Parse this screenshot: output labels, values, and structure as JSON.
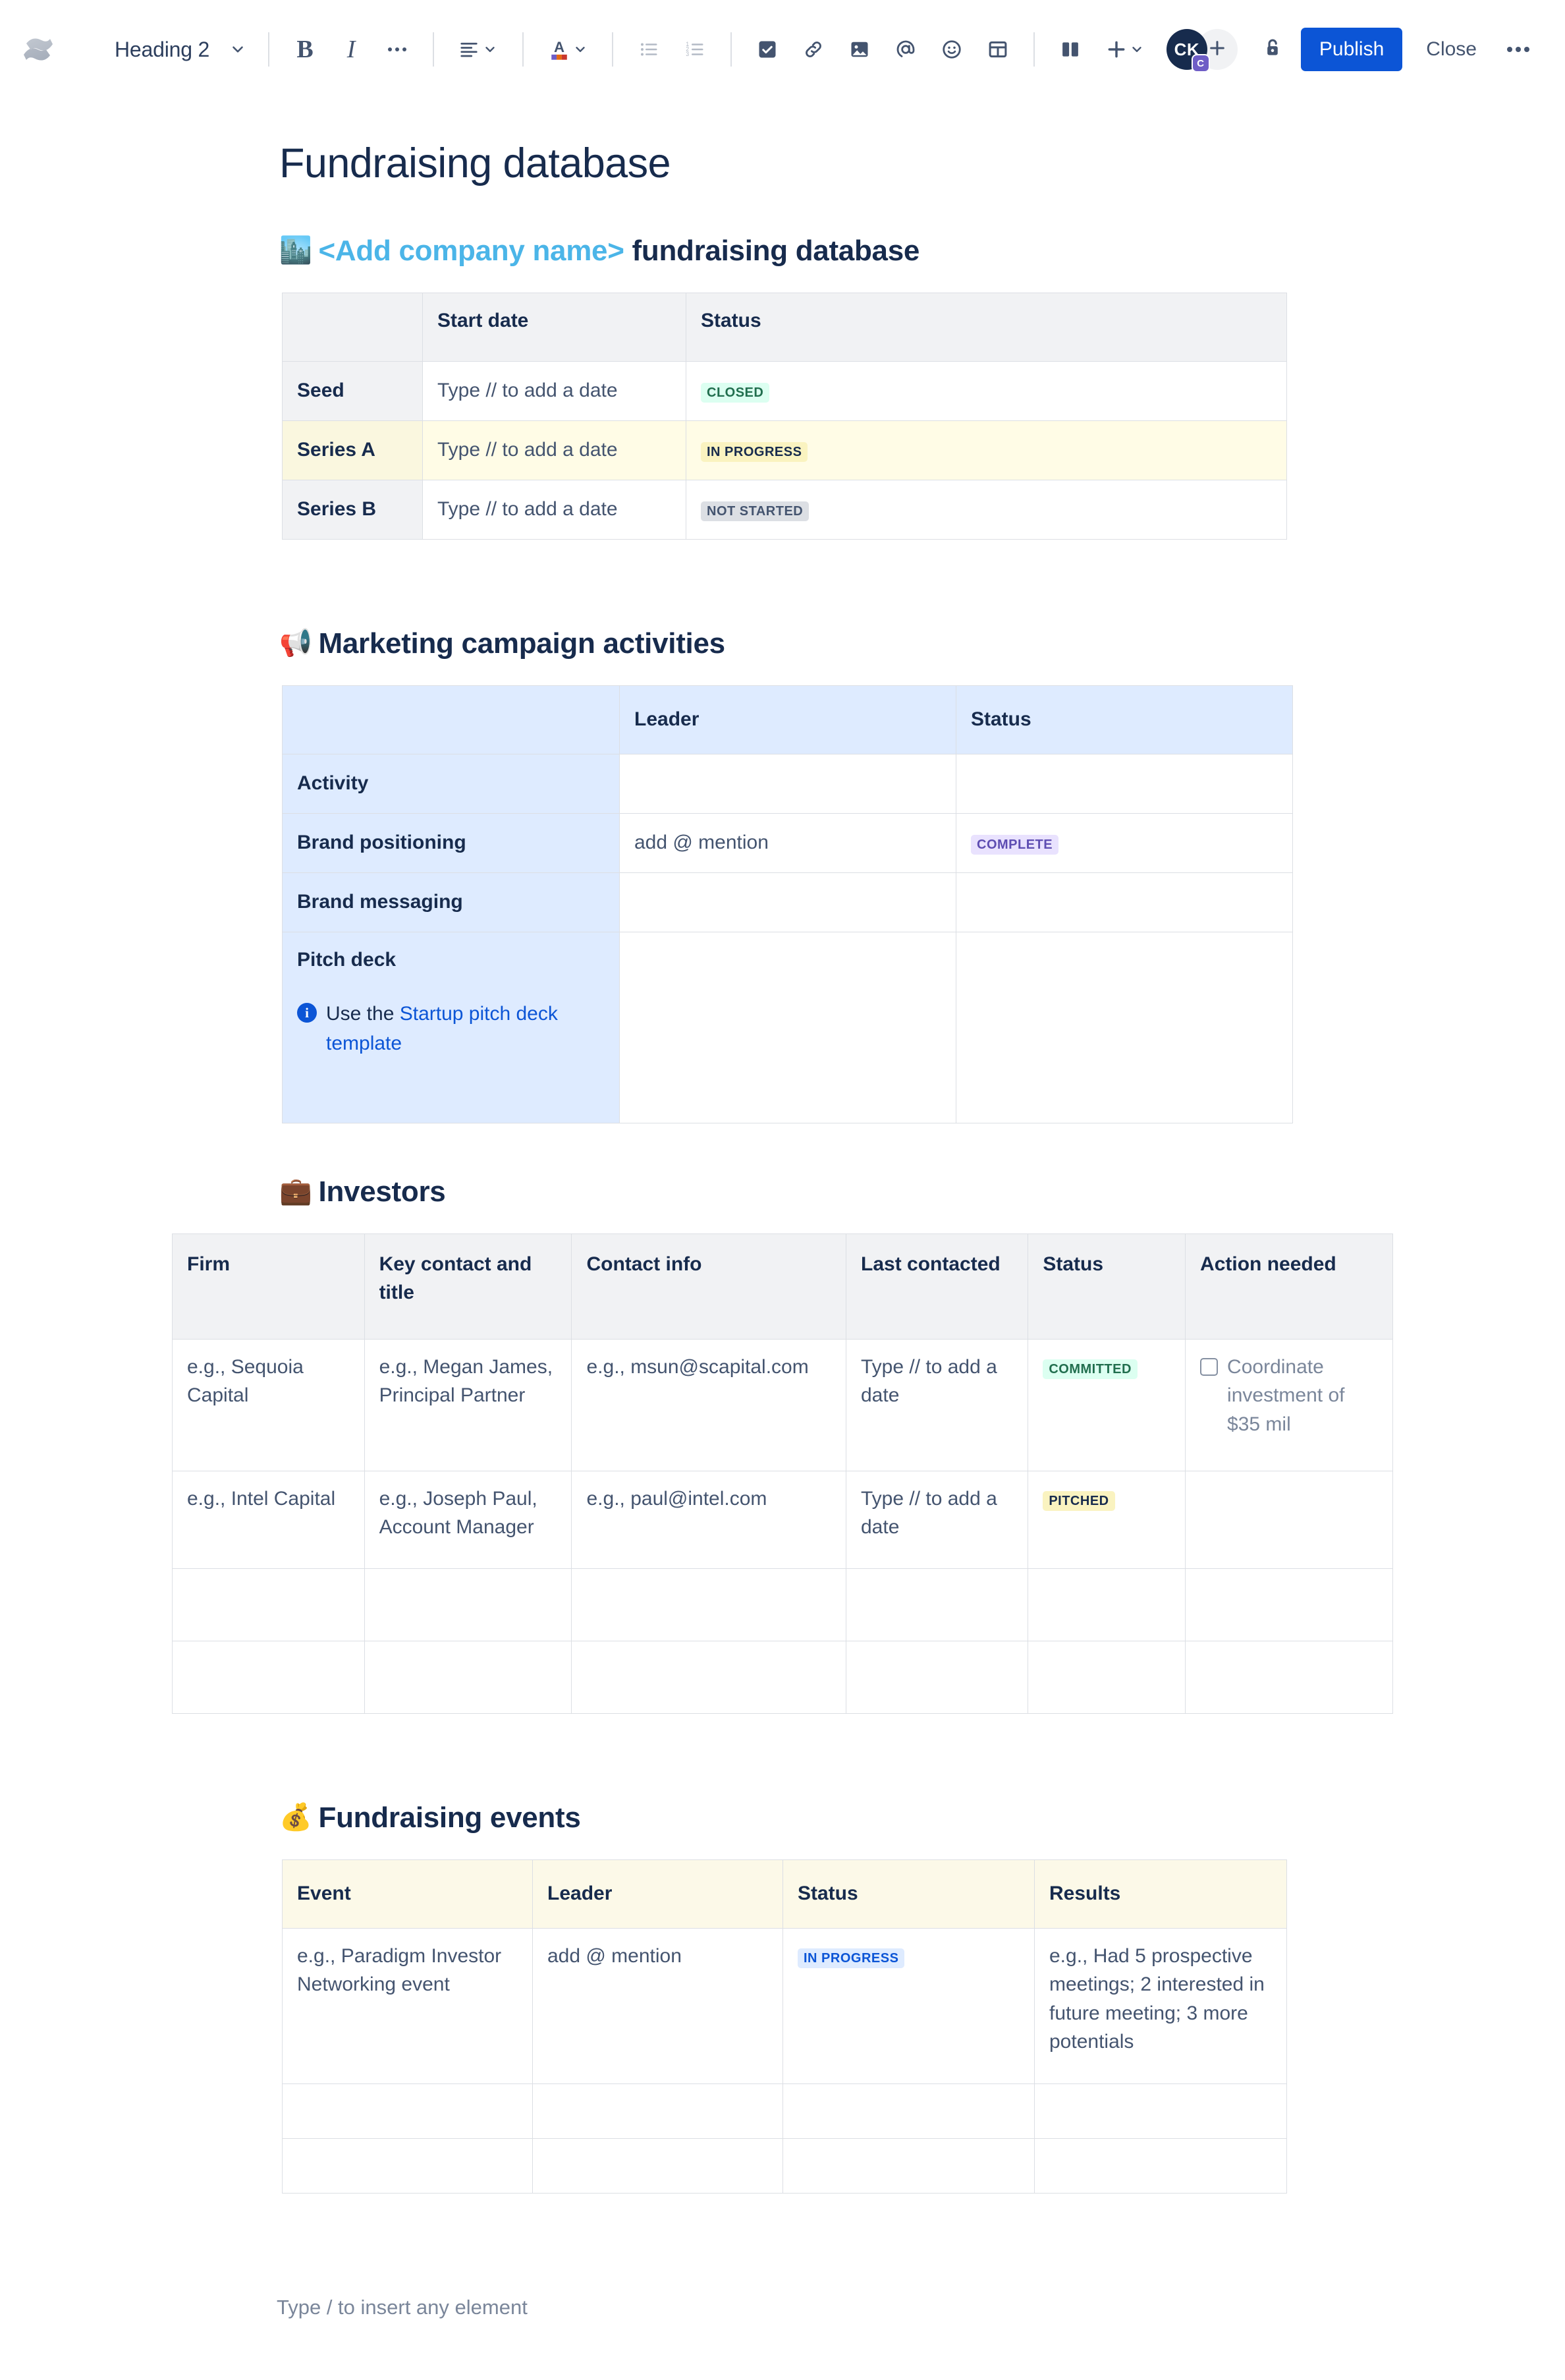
{
  "toolbar": {
    "logo_icon": "confluence-logo",
    "style_label": "Heading 2",
    "bold_label": "B",
    "italic_label": "I",
    "more_formatting_icon": "ellipsis-icon",
    "align_icon": "align-left-icon",
    "text_color_icon": "text-color-icon",
    "bullet_list_icon": "bullet-list-icon",
    "numbered_list_icon": "numbered-list-icon",
    "task_icon": "checkbox-task-icon",
    "link_icon": "link-icon",
    "image_icon": "image-icon",
    "mention_icon": "mention-at-icon",
    "emoji_icon": "emoji-smiley-icon",
    "table_icon": "table-icon",
    "layout_icon": "layout-columns-icon",
    "insert_icon": "plus-icon",
    "avatar_initials": "CK",
    "avatar_badge": "C",
    "add_people_icon": "plus-icon",
    "restrictions_icon": "unlock-icon",
    "publish_label": "Publish",
    "close_label": "Close",
    "more_actions_icon": "ellipsis-icon"
  },
  "page": {
    "title": "Fundraising database",
    "footer_placeholder": "Type / to insert any element"
  },
  "section_rounds": {
    "emoji": "🏙️",
    "emoji_name": "cityscape-emoji",
    "heading_accent": "<Add company name>",
    "heading_rest": " fundraising database",
    "accent_color": "#4BB5E8",
    "table": {
      "headers": [
        "",
        "Start date",
        "Status"
      ],
      "rows": [
        {
          "label": "Seed",
          "date": "Type // to add a date",
          "status": "CLOSED",
          "status_style": "green",
          "highlight": false
        },
        {
          "label": "Series A",
          "date": "Type // to add a date",
          "status": "IN PROGRESS",
          "status_style": "yellow",
          "highlight": true
        },
        {
          "label": "Series B",
          "date": "Type // to add a date",
          "status": "NOT STARTED",
          "status_style": "grey",
          "highlight": false
        }
      ]
    }
  },
  "section_marketing": {
    "emoji": "📢",
    "emoji_name": "loudspeaker-emoji",
    "heading": "Marketing campaign activities",
    "table": {
      "headers": [
        "",
        "Leader",
        "Status"
      ],
      "rows": [
        {
          "label": "Activity",
          "leader": "",
          "status": "",
          "status_style": ""
        },
        {
          "label": "Brand positioning",
          "leader": "add @ mention",
          "status": "COMPLETE",
          "status_style": "purple"
        },
        {
          "label": "Brand messaging",
          "leader": "",
          "status": "",
          "status_style": ""
        }
      ],
      "pitch_row": {
        "label": "Pitch deck",
        "note_icon": "info-icon",
        "note_prefix": "Use the ",
        "note_link": "Startup pitch deck template"
      }
    }
  },
  "section_investors": {
    "emoji": "💼",
    "emoji_name": "briefcase-emoji",
    "heading": "Investors",
    "table": {
      "headers": [
        "Firm",
        "Key contact and title",
        "Contact info",
        "Last contacted",
        "Status",
        "Action needed"
      ],
      "rows": [
        {
          "firm": "e.g., Sequoia Capital",
          "contact": "e.g., Megan James, Principal Partner",
          "info": "e.g., msun@scapital.com",
          "last": "Type // to add a date",
          "status": "COMMITTED",
          "status_style": "green",
          "action": "Coordinate investment of $35 mil",
          "action_checked": false
        },
        {
          "firm": "e.g., Intel Capital",
          "contact": "e.g., Joseph Paul, Account Manager",
          "info": "e.g., paul@intel.com",
          "last": "Type // to add a date",
          "status": "PITCHED",
          "status_style": "yellow",
          "action": "",
          "action_checked": null
        },
        {
          "firm": "",
          "contact": "",
          "info": "",
          "last": "",
          "status": "",
          "status_style": "",
          "action": "",
          "action_checked": null
        },
        {
          "firm": "",
          "contact": "",
          "info": "",
          "last": "",
          "status": "",
          "status_style": "",
          "action": "",
          "action_checked": null
        }
      ]
    }
  },
  "section_events": {
    "emoji": "💰",
    "emoji_name": "money-bag-emoji",
    "heading": "Fundraising events",
    "table": {
      "headers": [
        "Event",
        "Leader",
        "Status",
        "Results"
      ],
      "rows": [
        {
          "event": "e.g., Paradigm Investor Networking event",
          "leader": "add @ mention",
          "status": "IN PROGRESS",
          "status_style": "blue",
          "results": "e.g., Had 5 prospective meetings; 2 interested in future meeting; 3 more potentials"
        },
        {
          "event": "",
          "leader": "",
          "status": "",
          "status_style": "",
          "results": ""
        },
        {
          "event": "",
          "leader": "",
          "status": "",
          "status_style": "",
          "results": ""
        }
      ]
    }
  },
  "colors": {
    "brand_blue": "#0C55D6",
    "text_primary": "#172B4D",
    "text_subtle": "#44546F",
    "placeholder": "#7A869A",
    "border": "#DCDFE4",
    "header_grey": "#F1F2F4",
    "header_blue": "#DEEBFF",
    "header_cream": "#FCF9E8",
    "highlight_row": "#FFFCE6"
  }
}
